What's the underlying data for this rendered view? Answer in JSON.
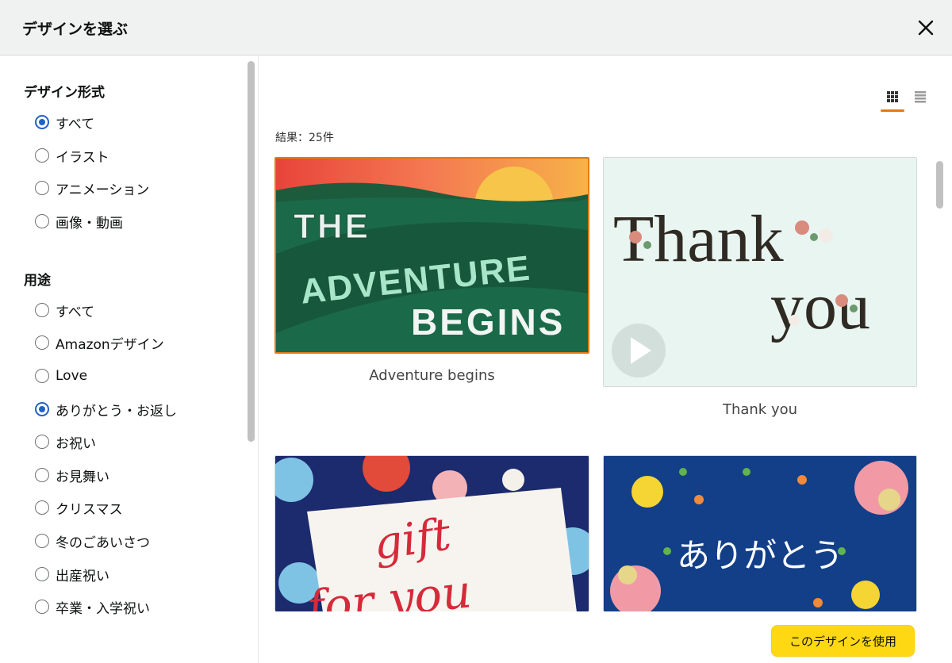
{
  "dialog": {
    "title": "デザインを選ぶ",
    "close_icon": "close-icon"
  },
  "sidebar": {
    "format": {
      "title": "デザイン形式",
      "options": [
        {
          "label": "すべて",
          "checked": true
        },
        {
          "label": "イラスト",
          "checked": false
        },
        {
          "label": "アニメーション",
          "checked": false
        },
        {
          "label": "画像・動画",
          "checked": false
        }
      ]
    },
    "usage": {
      "title": "用途",
      "options": [
        {
          "label": "すべて",
          "checked": false
        },
        {
          "label": "Amazonデザイン",
          "checked": false
        },
        {
          "label": "Love",
          "checked": false
        },
        {
          "label": "ありがとう・お返し",
          "checked": true
        },
        {
          "label": "お祝い",
          "checked": false
        },
        {
          "label": "お見舞い",
          "checked": false
        },
        {
          "label": "クリスマス",
          "checked": false
        },
        {
          "label": "冬のごあいさつ",
          "checked": false
        },
        {
          "label": "出産祝い",
          "checked": false
        },
        {
          "label": "卒業・入学祝い",
          "checked": false
        }
      ]
    }
  },
  "main": {
    "result_count": "結果：25件",
    "view_modes": {
      "grid_icon": "grid-view-icon",
      "list_icon": "list-view-icon",
      "active": "grid"
    },
    "designs": [
      {
        "label": "Adventure begins",
        "art_text": [
          "THE",
          "ADVENTURE",
          "BEGINS"
        ],
        "selected": true
      },
      {
        "label": "Thank you",
        "art_text": [
          "Thank",
          "you"
        ],
        "selected": false,
        "has_play_icon": true
      },
      {
        "label": "",
        "art_text": [
          "gift",
          "for you"
        ],
        "selected": false
      },
      {
        "label": "",
        "art_text": [
          "ありがとう"
        ],
        "selected": false
      }
    ],
    "use_button": "このデザインを使用"
  },
  "colors": {
    "accent": "#e47911",
    "radio": "#2162c9",
    "button": "#ffd814"
  }
}
